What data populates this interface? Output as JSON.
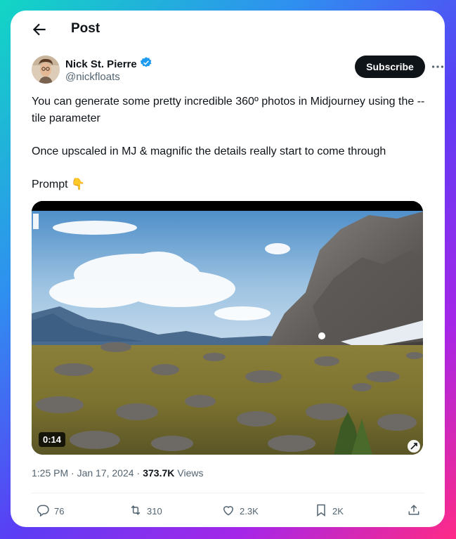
{
  "header": {
    "title": "Post",
    "back_icon": "arrow-left-icon"
  },
  "author": {
    "name": "Nick St. Pierre",
    "handle": "@nickfloats",
    "verified_icon": "verified-badge-icon",
    "subscribe_label": "Subscribe",
    "more_icon": "more-horizontal-icon"
  },
  "post": {
    "paragraphs": [
      "You can generate some pretty incredible 360º photos in Midjourney using the --tile parameter",
      "Once upscaled in MJ & magnific the details really start to come through",
      "Prompt 👇"
    ],
    "video_duration": "0:14"
  },
  "meta": {
    "time": "1:25 PM · Jan 17, 2024",
    "separator": "·",
    "views_count": "373.7K",
    "views_label": "Views"
  },
  "actions": [
    {
      "icon": "reply-icon",
      "count": "76"
    },
    {
      "icon": "repost-icon",
      "count": "310"
    },
    {
      "icon": "like-icon",
      "count": "2.3K"
    },
    {
      "icon": "bookmark-icon",
      "count": "2K"
    },
    {
      "icon": "share-icon",
      "count": ""
    }
  ],
  "colors": {
    "text": "#0f1419",
    "secondary": "#536471",
    "verified": "#1d9bf0"
  }
}
